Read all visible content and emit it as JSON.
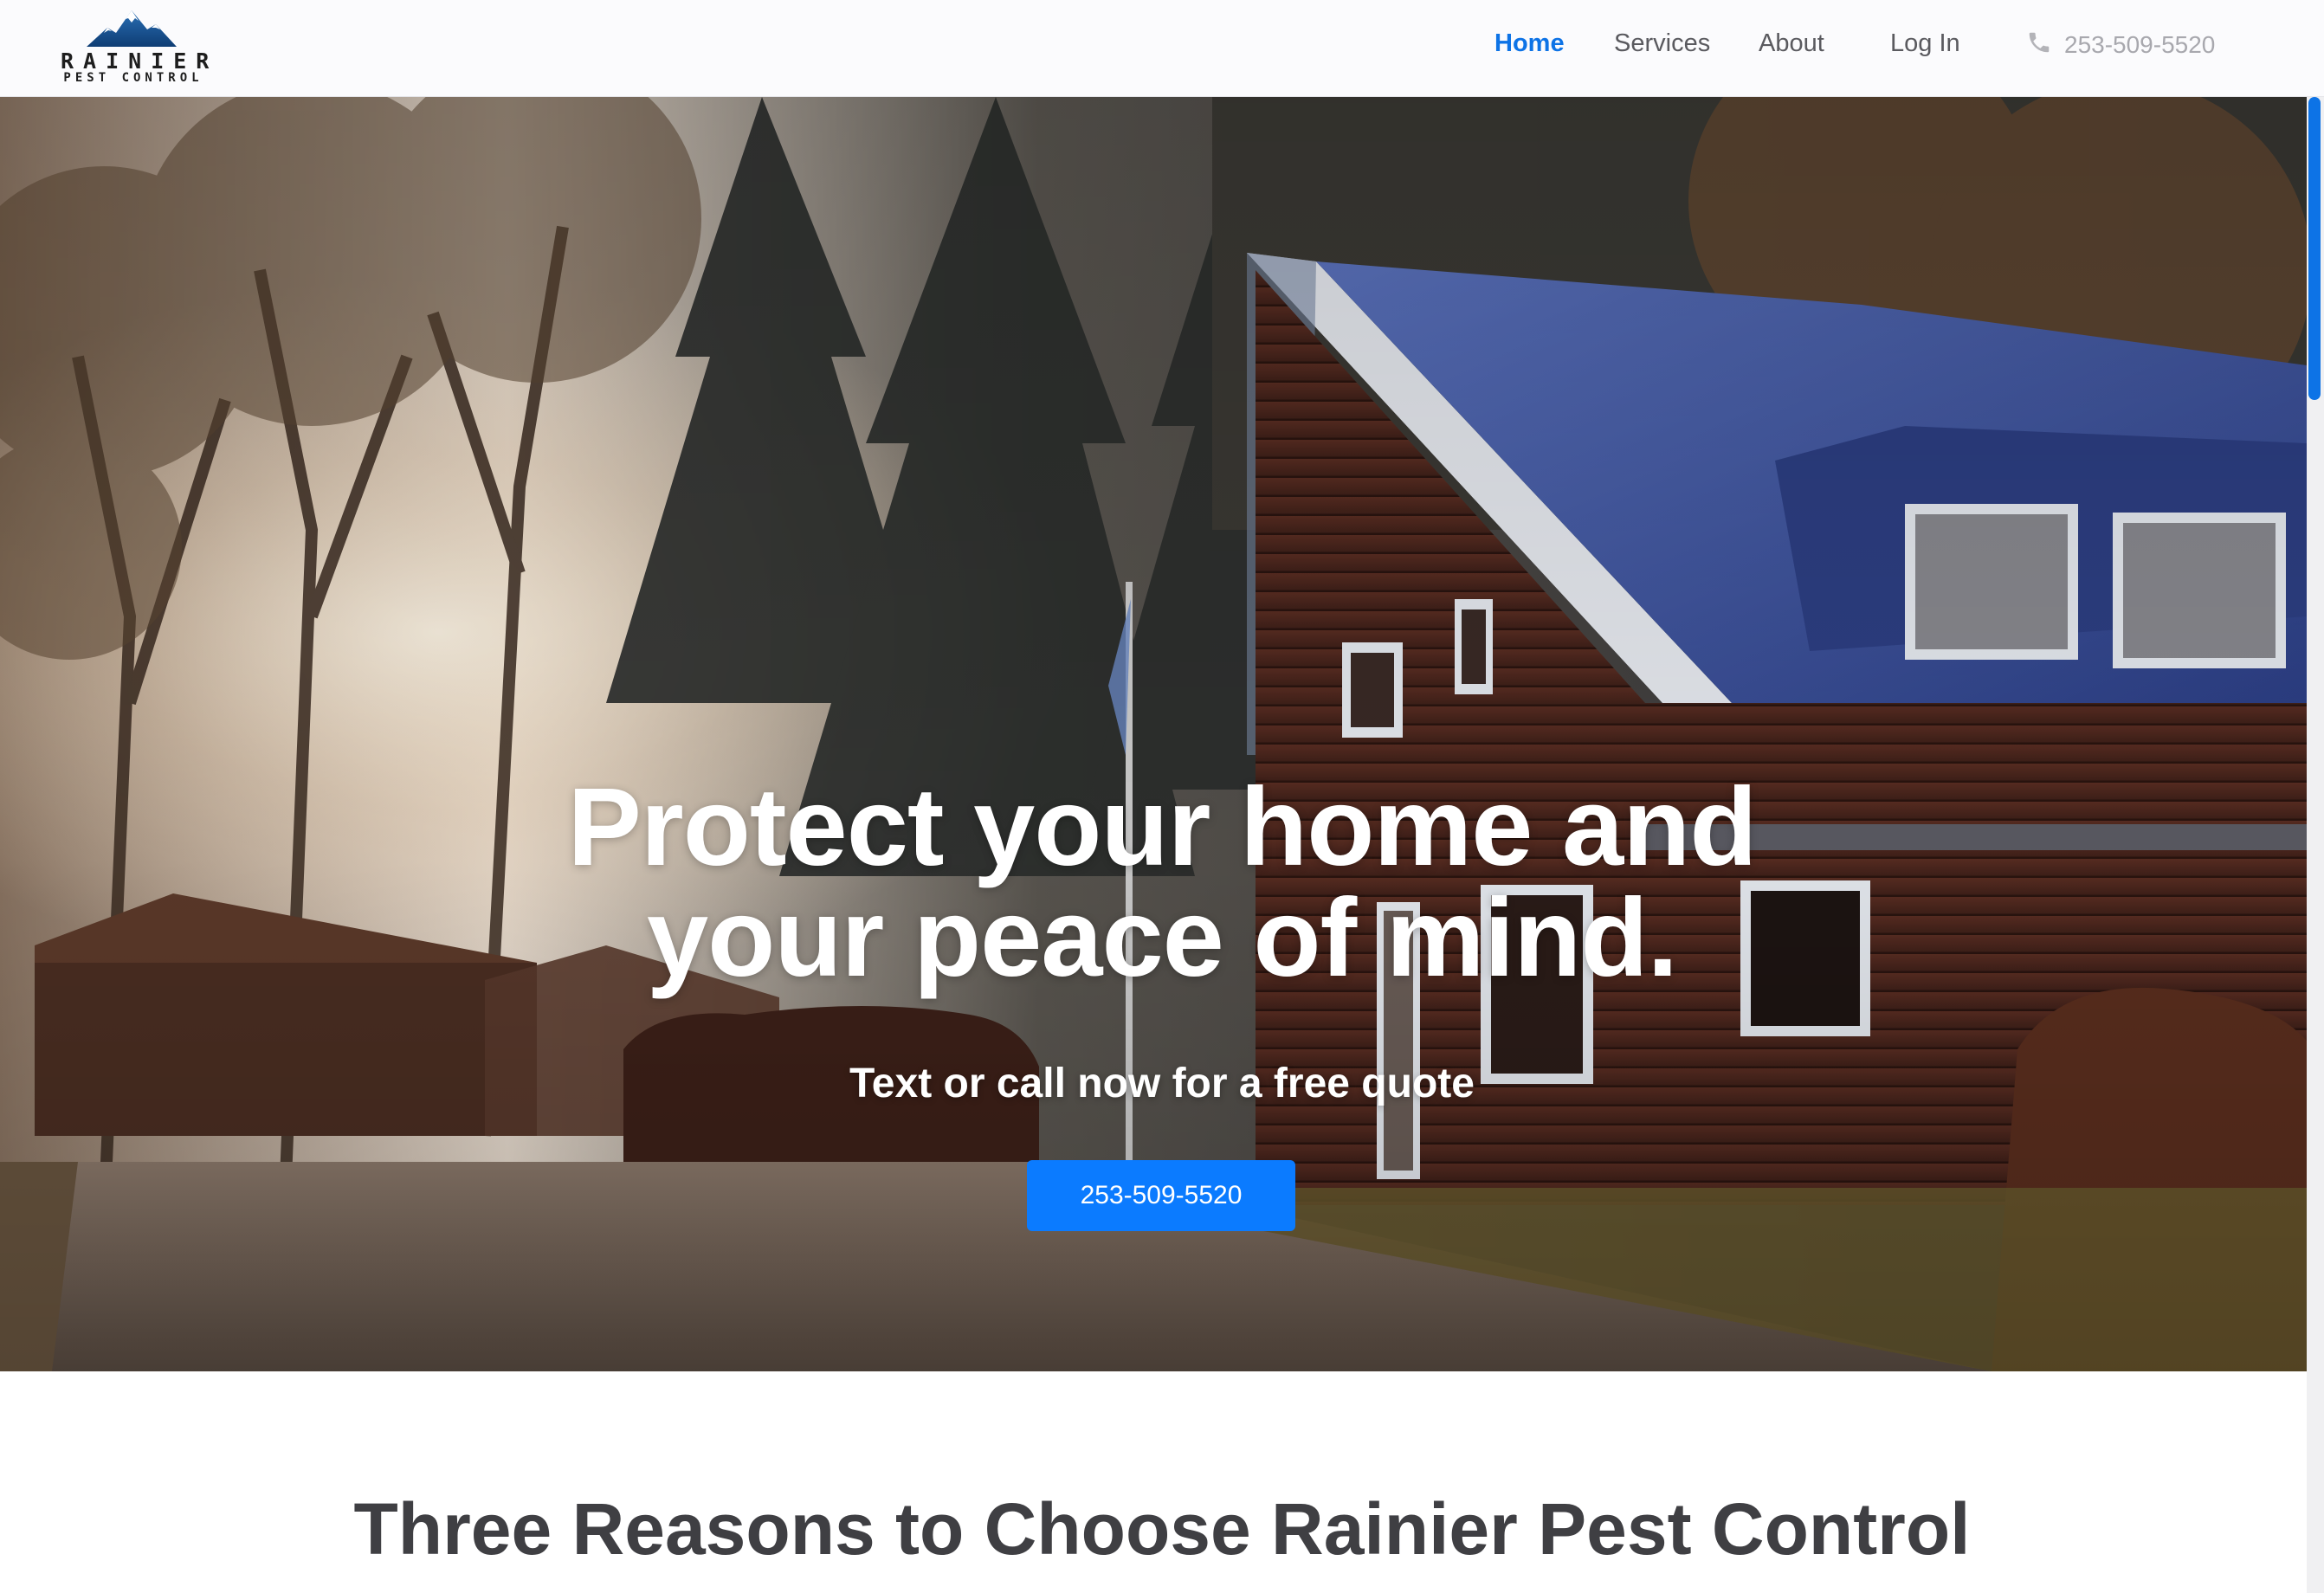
{
  "brand": {
    "name_line1": "RAINIER",
    "name_line2": "PEST CONTROL",
    "logo_icon": "mountain-icon"
  },
  "nav": {
    "items": [
      {
        "label": "Home",
        "active": true
      },
      {
        "label": "Services",
        "active": false
      },
      {
        "label": "About",
        "active": false
      },
      {
        "label": "Log In",
        "active": false
      }
    ],
    "phone": "253-509-5520",
    "phone_icon": "phone-icon"
  },
  "hero": {
    "title": "Protect your home and your peace of mind.",
    "subtitle": "Text or call now for a free quote",
    "cta_label": "253-509-5520"
  },
  "reasons": {
    "heading": "Three Reasons to Choose Rainier Pest Control"
  },
  "colors": {
    "accent": "#0b7bff",
    "nav_active": "#0d73e6",
    "nav_text": "#5a5a5f",
    "heading": "#3f3f43"
  }
}
